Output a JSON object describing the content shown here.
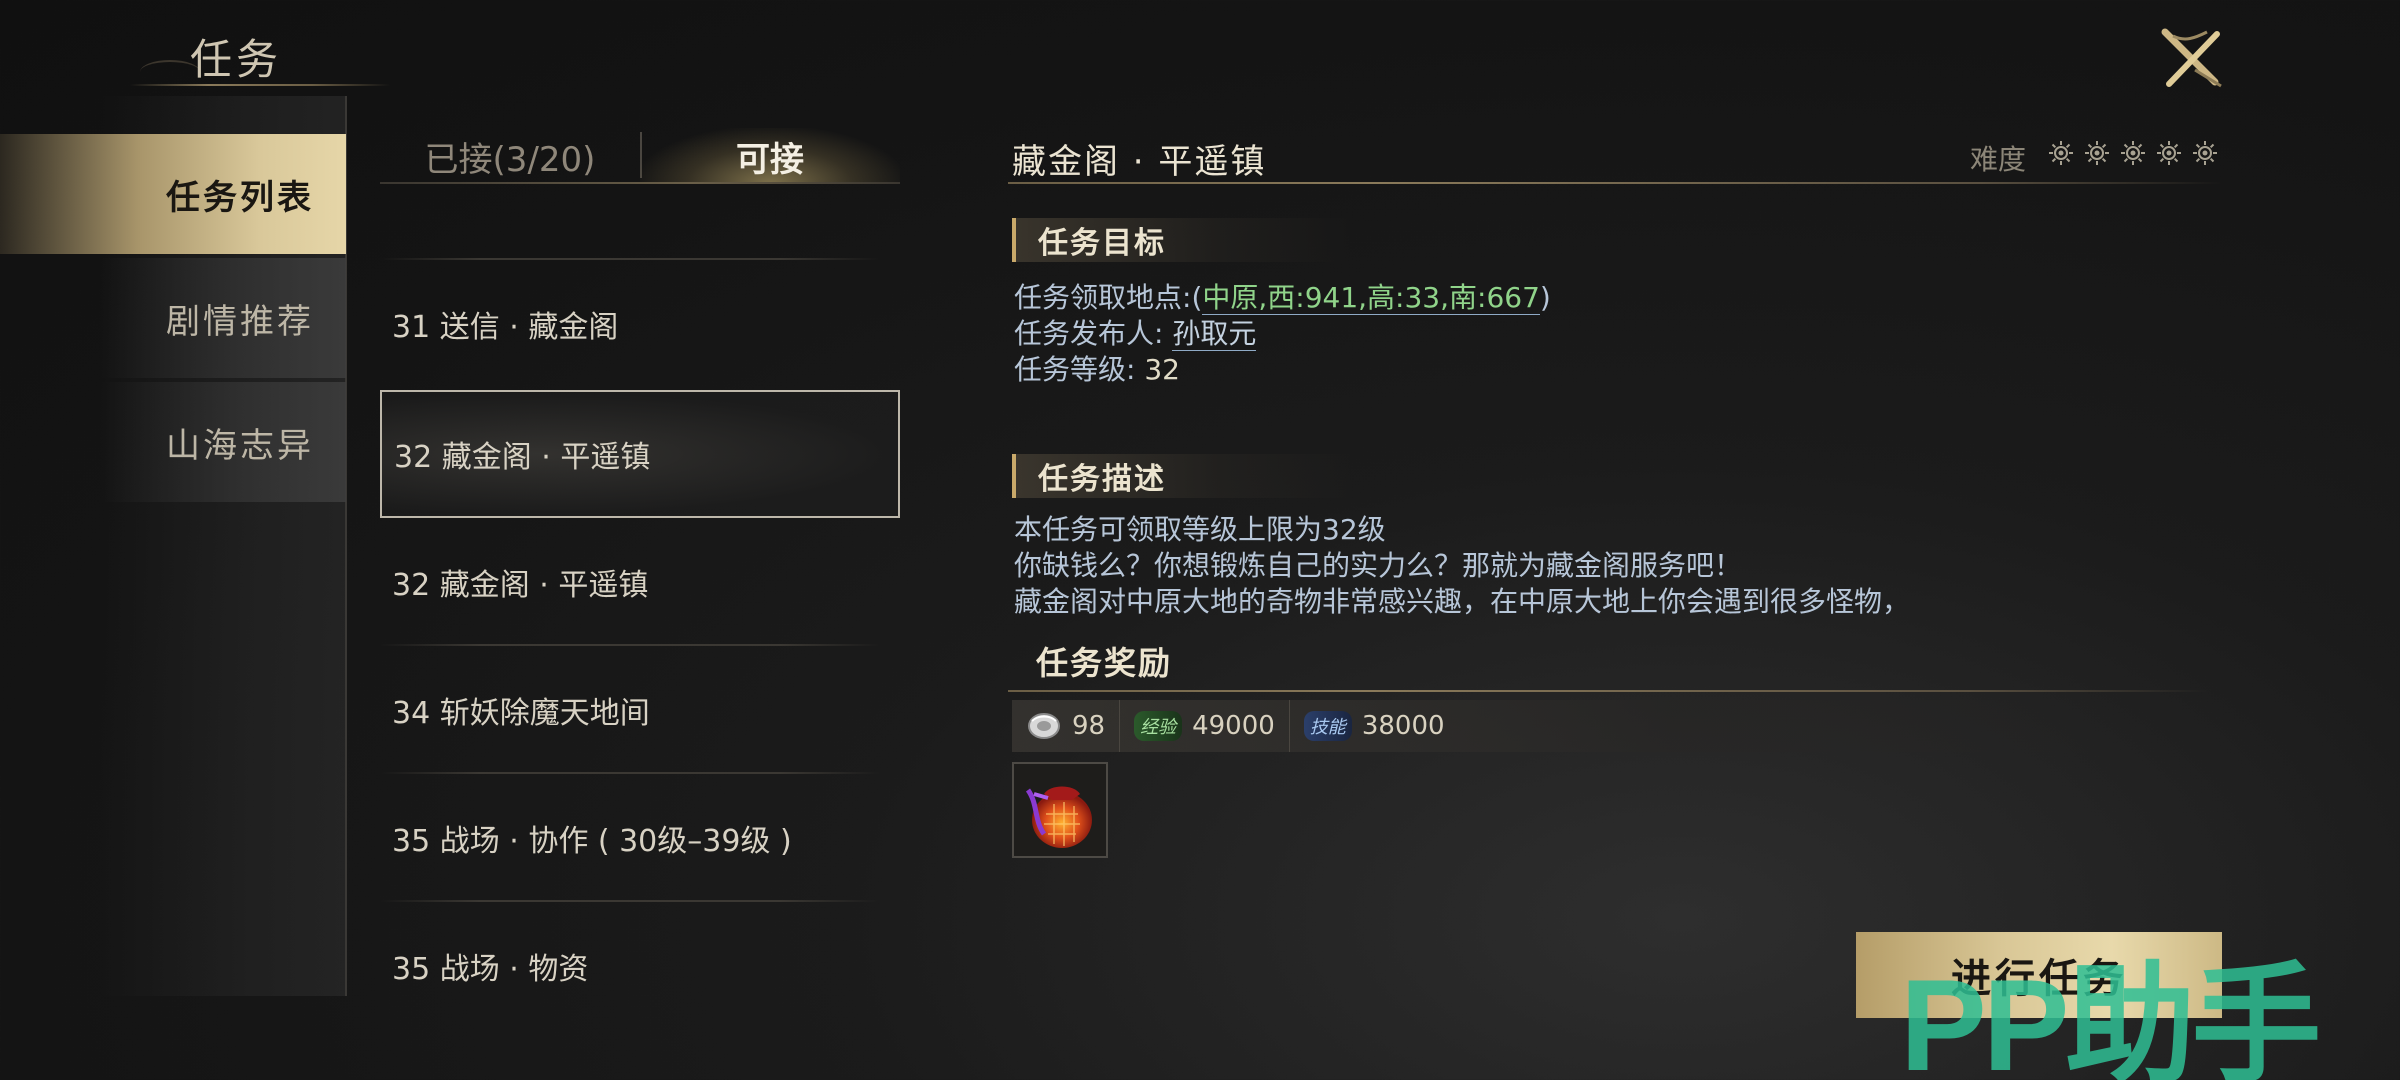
{
  "window": {
    "title": "任务",
    "close_icon": "close-x-icon"
  },
  "nav": {
    "items": [
      {
        "label": "任务列表",
        "active": true
      },
      {
        "label": "剧情推荐",
        "active": false
      },
      {
        "label": "山海志异",
        "active": false
      }
    ]
  },
  "tabs": {
    "accepted": "已接(3/20)",
    "available": "可接",
    "selected": "可接"
  },
  "quests": [
    {
      "label": "31 送信 · 藏金阁",
      "selected": false
    },
    {
      "label": "32 藏金阁 · 平遥镇",
      "selected": true
    },
    {
      "label": "32 藏金阁 · 平遥镇",
      "selected": false
    },
    {
      "label": "34 斩妖除魔天地间",
      "selected": false
    },
    {
      "label": "35 战场 · 协作 ( 30级–39级 )",
      "selected": false
    },
    {
      "label": "35 战场 · 物资",
      "selected": false
    }
  ],
  "detail": {
    "title": "藏金阁 · 平遥镇",
    "difficulty_label": "难度",
    "difficulty_level": 5,
    "objective_heading": "任务目标",
    "location_label": "任务领取地点:",
    "location_open": "(",
    "location_value": "中原,西:941,高:33,南:667",
    "location_close": ")",
    "publisher_label": "任务发布人: ",
    "publisher_value": "孙取元",
    "level_label": "任务等级: ",
    "level_value": "32",
    "description_heading": "任务描述",
    "description_lines": [
      "本任务可领取等级上限为32级",
      "你缺钱么？你想锻炼自己的实力么？那就为藏金阁服务吧！",
      "藏金阁对中原大地的奇物非常感兴趣，在中原大地上你会遇到很多怪物，"
    ],
    "reward_heading": "任务奖励",
    "rewards": {
      "coin": "98",
      "exp_badge": "经验",
      "exp": "49000",
      "skill_badge": "技能",
      "skill": "38000"
    },
    "reward_item_icon": "treasure-pouch-icon"
  },
  "action": {
    "go_label": "进行任务"
  },
  "watermark": {
    "text": "PP助手"
  },
  "colors": {
    "accent_gold": "#d9c796",
    "link_green": "#90d48a",
    "info_blue": "#b7c6d8",
    "watermark_green": "#2fbf94"
  }
}
